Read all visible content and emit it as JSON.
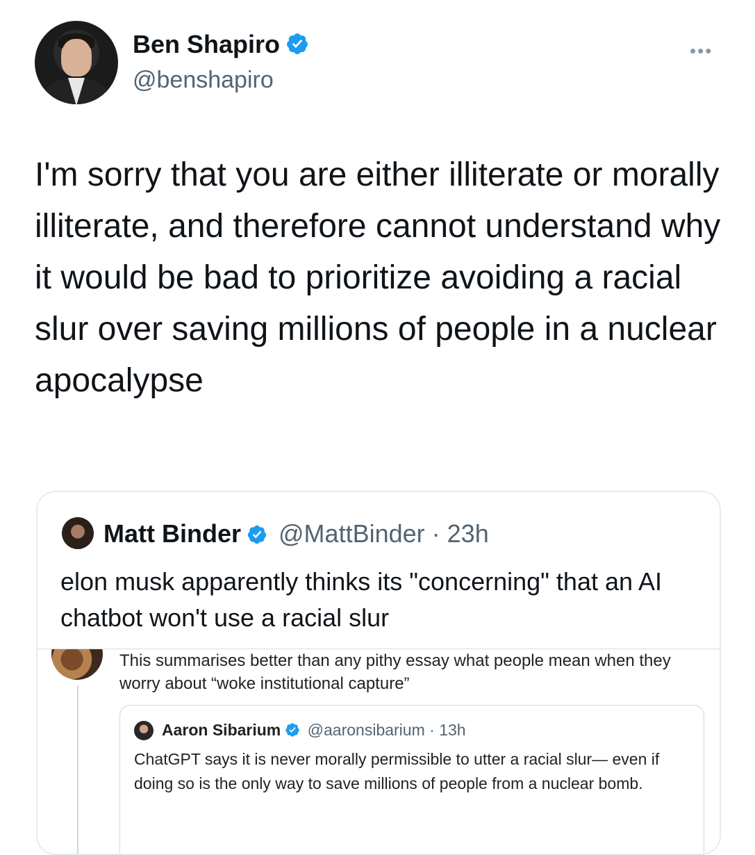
{
  "tweet": {
    "author": {
      "name": "Ben Shapiro",
      "handle": "@benshapiro"
    },
    "more_icon": "more-horizontal-icon",
    "text": "I'm sorry that you are either illiterate or morally illiterate, and therefore cannot understand why it would be bad to prioritize avoiding a racial slur over saving millions of people in a nuclear apocalypse"
  },
  "quote": {
    "author": {
      "name": "Matt Binder",
      "handle": "@MattBinder",
      "time": "· 23h"
    },
    "text": "elon musk apparently thinks its \"concerning\" that an AI chatbot won't use a racial slur",
    "embedded": {
      "text": "This summarises better than any pithy essay what people mean when they worry about “woke institutional capture”",
      "nested": {
        "name": "Aaron Sibarium",
        "handle": "@aaronsibarium",
        "time": "· 13h",
        "text": "ChatGPT says it is never morally permissible to utter a racial slur— even if doing so is the only way to save millions of people from a nuclear bomb."
      }
    }
  },
  "colors": {
    "verified": "#1d9bf0",
    "secondary_text": "#536471",
    "border": "#e6ecf0"
  }
}
